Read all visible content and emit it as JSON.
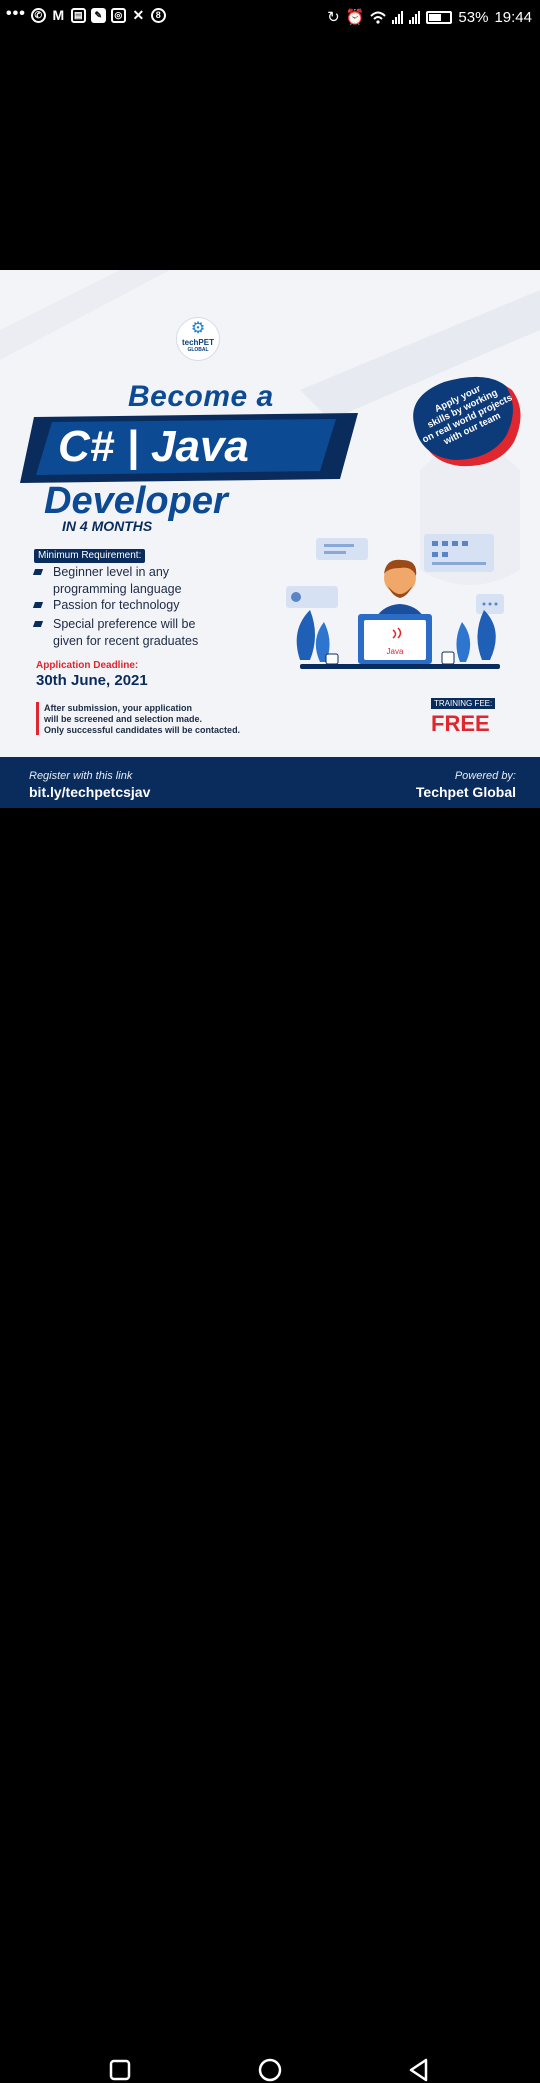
{
  "status_bar": {
    "battery": "53%",
    "battery_level": 0.53,
    "time": "19:44",
    "left_icons": [
      "more-dots-icon",
      "whatsapp-icon",
      "gmail-icon",
      "gallery-icon",
      "messages-icon",
      "instagram-icon",
      "missed-call-icon",
      "app-8-icon"
    ],
    "right_icons": [
      "sync-icon",
      "alarm-icon",
      "wifi-icon",
      "signal-icon",
      "signal-icon-2",
      "battery-icon"
    ]
  },
  "poster": {
    "logo": {
      "name": "techPET",
      "sub": "GLOBAL"
    },
    "headline": {
      "line1": "Become a",
      "line2": "C# | Java",
      "line3": "Developer",
      "duration": "IN 4 MONTHS"
    },
    "badge": {
      "line1": "Apply your",
      "line2": "skills by working",
      "line3": "on real world projects",
      "line4": "with our team"
    },
    "requirements": {
      "title": "Minimum Requirement:",
      "items": [
        [
          "Beginner level in any",
          "programming language"
        ],
        [
          "Passion for technology"
        ],
        [
          "Special preference will be",
          "given for recent graduates"
        ]
      ]
    },
    "deadline": {
      "label": "Application Deadline:",
      "date": "30th June, 2021"
    },
    "note": [
      "After submission, your application",
      "will be screened and selection made.",
      "Only successful candidates will be contacted."
    ],
    "training_fee": {
      "label": "TRAINING FEE:",
      "value": "FREE"
    },
    "illustration": {
      "laptop_label": "Java"
    },
    "footer": {
      "register_label": "Register with this link",
      "link": "bit.ly/techpetcsjav",
      "powered_label": "Powered by:",
      "company": "Techpet Global"
    },
    "colors": {
      "navy": "#0a2c5c",
      "blue": "#0d4a94",
      "red": "#e0262e",
      "background": "#f3f4f8"
    }
  },
  "nav_bar": {
    "icons": [
      "recents-square-icon",
      "home-circle-icon",
      "back-triangle-icon"
    ]
  }
}
